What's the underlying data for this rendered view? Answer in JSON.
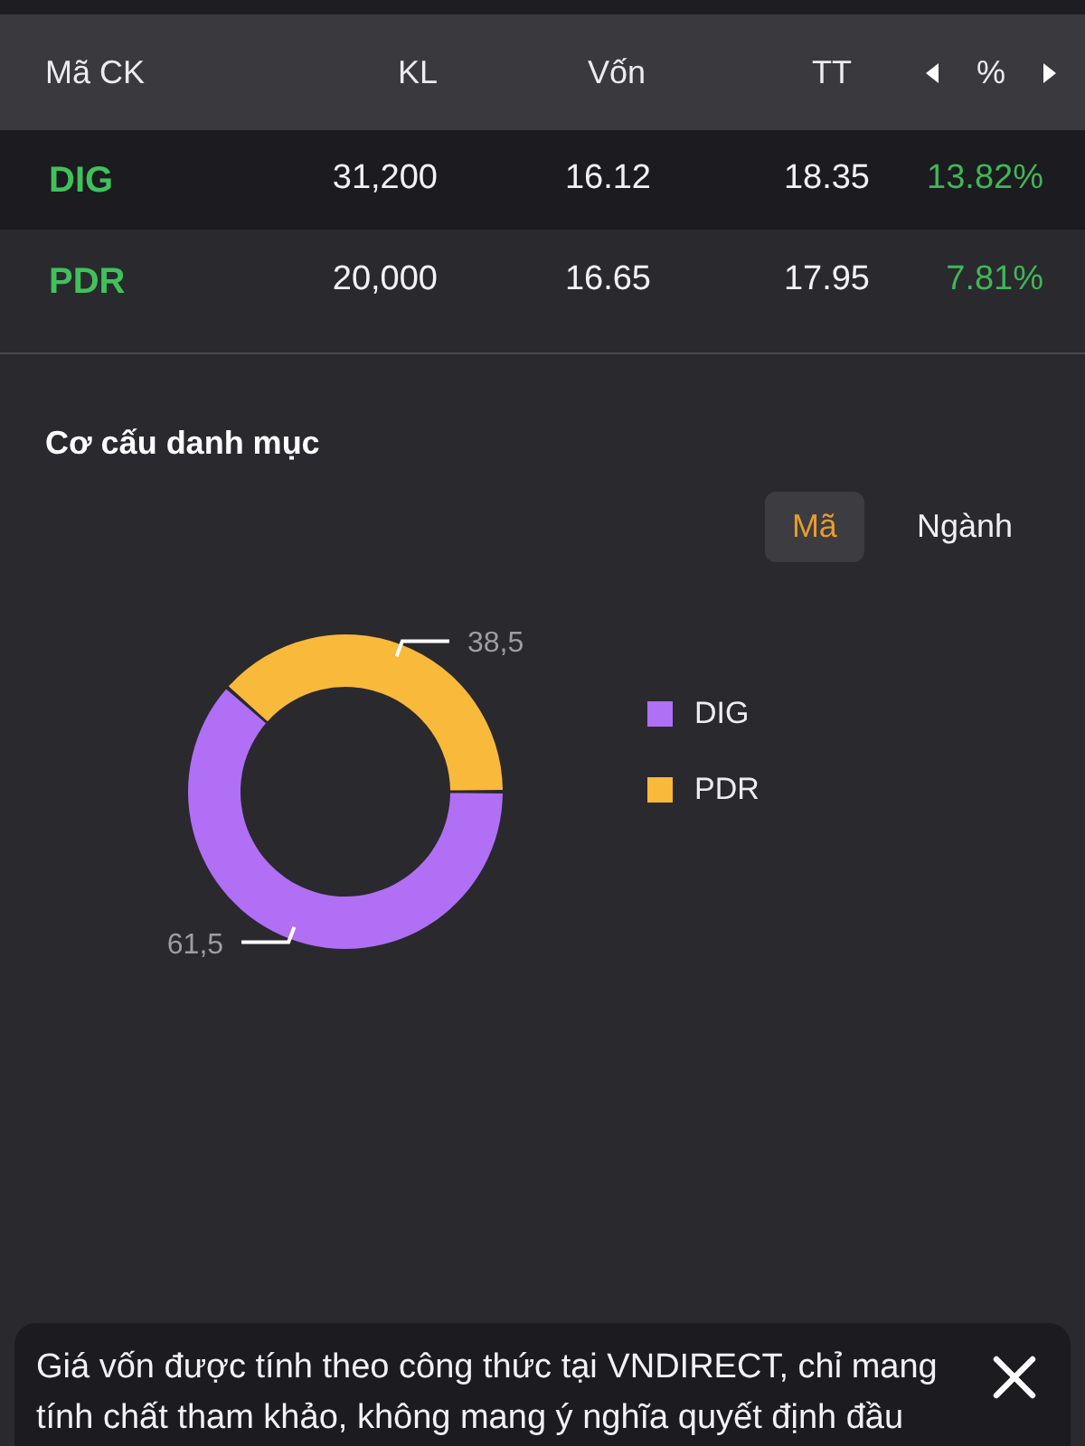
{
  "table": {
    "columns": [
      {
        "label": "Mã CK"
      },
      {
        "label": "KL"
      },
      {
        "label": "Vốn"
      },
      {
        "label": "TT"
      },
      {
        "label": "%"
      }
    ],
    "rows": [
      {
        "cells": [
          "DIG",
          "31,200",
          "16.12",
          "18.35",
          "13.82%"
        ]
      },
      {
        "cells": [
          "PDR",
          "20,000",
          "16.65",
          "17.95",
          "7.81%"
        ]
      }
    ]
  },
  "portfolio": {
    "title": "Cơ cấu danh mục",
    "tabs": [
      {
        "label": "Mã",
        "selected": true
      },
      {
        "label": "Ngành",
        "selected": false
      }
    ],
    "chart_data": {
      "type": "donut",
      "categories": [
        "DIG",
        "PDR"
      ],
      "values": [
        61.5,
        38.5
      ],
      "colors": [
        "#b06ff5",
        "#f9b93a"
      ],
      "value_labels": [
        "61,5",
        "38,5"
      ]
    }
  },
  "notice": {
    "lines": [
      "Giá vốn được tính theo công thức tại VNDIRECT, chỉ mang",
      "tính chất tham khảo, không mang ý nghĩa quyết định đầu"
    ]
  }
}
